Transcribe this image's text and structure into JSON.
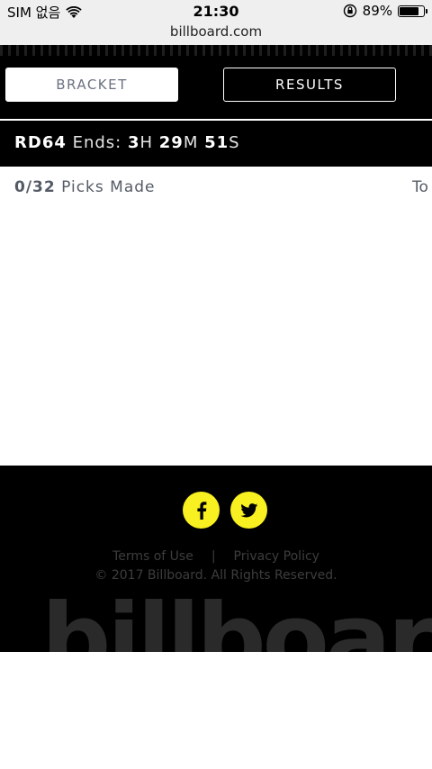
{
  "status_bar": {
    "carrier": "SIM 없음",
    "time": "21:30",
    "battery": "89%",
    "battery_level": 0.89
  },
  "browser": {
    "url": "billboard.com"
  },
  "header": {
    "bracket_label": "BRACKET",
    "results_label": "RESULTS",
    "round": {
      "rd_prefix": "RD",
      "rd_number": "64",
      "ends_label": " Ends: ",
      "hours": "3",
      "hours_unit": "H",
      "minutes": "29",
      "minutes_unit": "M",
      "seconds": "51",
      "seconds_unit": "S"
    }
  },
  "content": {
    "picks_count": "0/32",
    "picks_label": " Picks Made",
    "truncated_right": "To"
  },
  "footer": {
    "facebook_icon": "facebook-icon",
    "twitter_icon": "twitter-icon",
    "terms_label": "Terms of Use",
    "separator": "|",
    "privacy_label": "Privacy Policy",
    "copyright": "© 2017 Billboard. All Rights Reserved.",
    "wordmark": "billboard",
    "accent_color": "#f8f020"
  }
}
